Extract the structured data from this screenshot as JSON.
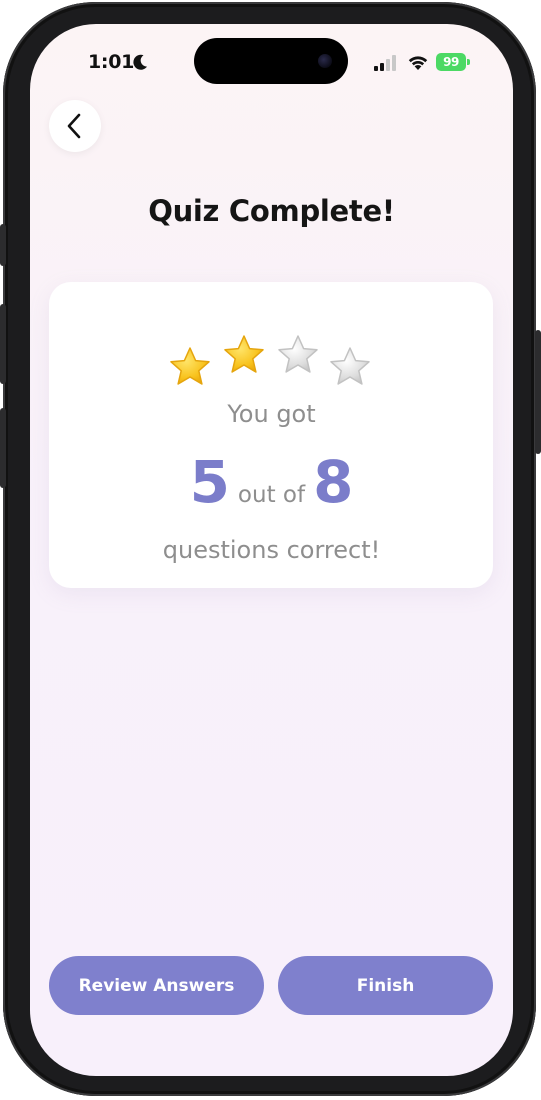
{
  "status_bar": {
    "time": "1:01",
    "focus_icon": "moon-icon",
    "battery_level": "99"
  },
  "header": {
    "back_icon": "chevron-left-icon",
    "title": "Quiz Complete!"
  },
  "result": {
    "stars_total": 4,
    "stars_filled": 2,
    "you_got_text": "You got",
    "correct": "5",
    "out_of_text": "out of",
    "total": "8",
    "questions_text": "questions correct!"
  },
  "actions": {
    "review_label": "Review Answers",
    "finish_label": "Finish"
  },
  "colors": {
    "accent": "#7f80cd",
    "score": "#7b7dca",
    "star_gold": "#f8c21c",
    "star_grey": "#d9d9d9",
    "muted_text": "#8e8e8e"
  }
}
